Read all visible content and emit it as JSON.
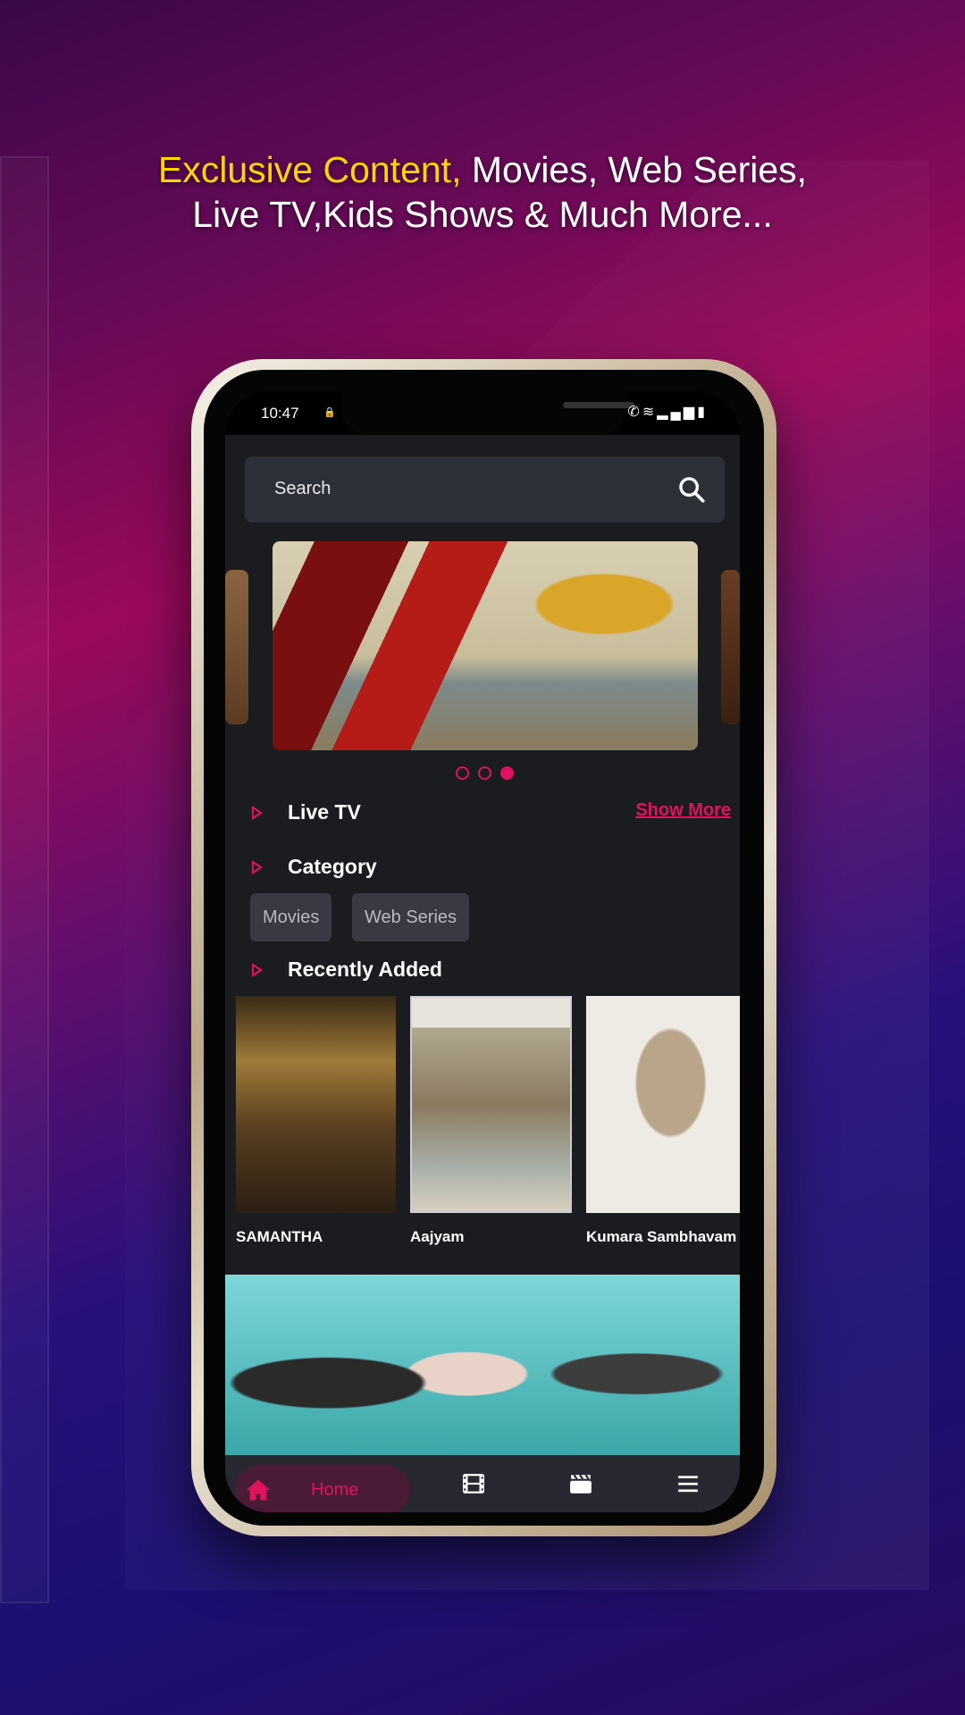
{
  "headline": {
    "highlight": "Exclusive Content,",
    "line1_rest": " Movies, Web Series,",
    "line2": "Live TV,Kids Shows & Much More..."
  },
  "status_bar": {
    "time": "10:47"
  },
  "search": {
    "placeholder": "Search",
    "icon": "search-icon"
  },
  "carousel": {
    "pages": 3,
    "active_index": 2
  },
  "sections": {
    "live_tv": "Live TV",
    "show_more": "Show More",
    "category": "Category",
    "recently_added": "Recently Added"
  },
  "categories": [
    "Movies",
    "Web Series"
  ],
  "recently_added": [
    {
      "title": "SAMANTHA"
    },
    {
      "title": "Aajyam"
    },
    {
      "title": "Kumara Sambhavam"
    }
  ],
  "bottom_nav": {
    "home": "Home",
    "items": [
      "movies-icon",
      "clapper-icon",
      "menu-icon"
    ]
  },
  "colors": {
    "accent": "#e0115f",
    "headline_highlight": "#ffd400",
    "surface": "#1b1c20"
  }
}
